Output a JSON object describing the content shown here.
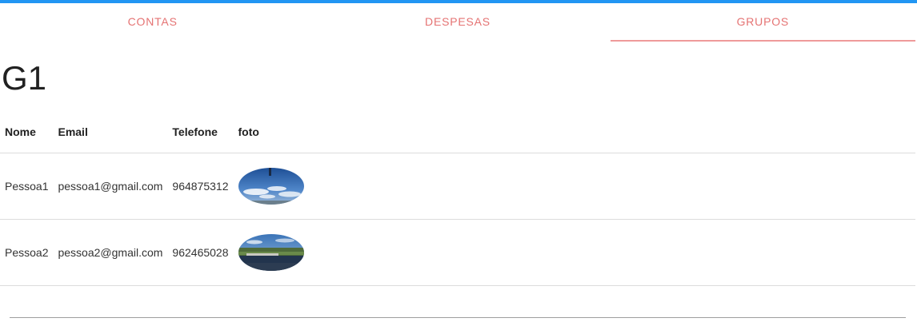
{
  "tabs": [
    {
      "label": "CONTAS",
      "active": false
    },
    {
      "label": "DESPESAS",
      "active": false
    },
    {
      "label": "GRUPOS",
      "active": true
    }
  ],
  "group": {
    "title": "G1"
  },
  "table": {
    "headers": {
      "name": "Nome",
      "email": "Email",
      "phone": "Telefone",
      "photo": "foto"
    },
    "rows": [
      {
        "name": "Pessoa1",
        "email": "pessoa1@gmail.com",
        "phone": "964875312",
        "photo": "sky-photo"
      },
      {
        "name": "Pessoa2",
        "email": "pessoa2@gmail.com",
        "phone": "962465028",
        "photo": "landscape-photo"
      }
    ]
  },
  "colors": {
    "top_bar": "#2196f3",
    "tab_text": "#e57373",
    "tab_indicator": "#ef9a9a"
  }
}
